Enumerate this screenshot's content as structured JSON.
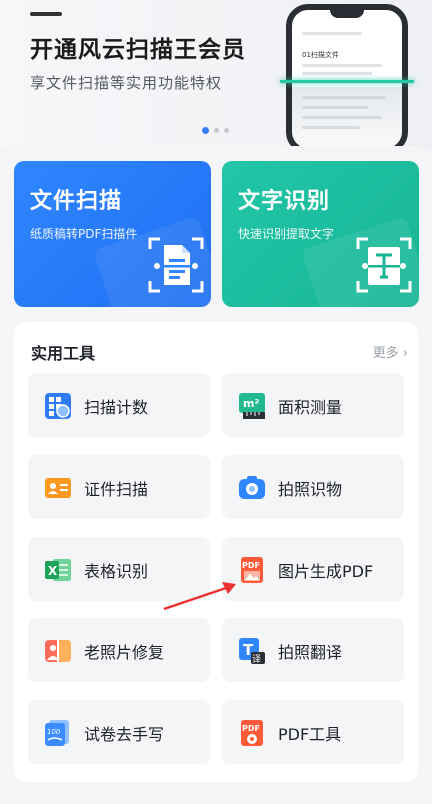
{
  "banner": {
    "title": "开通风云扫描王会员",
    "subtitle": "享文件扫描等实用功能特权",
    "phone_doc_title": "01扫描文件",
    "carousel_dots": 3,
    "active_dot": 0
  },
  "features": [
    {
      "title": "文件扫描",
      "subtitle": "纸质稿转PDF扫描件",
      "icon": "document-scan-icon"
    },
    {
      "title": "文字识别",
      "subtitle": "快速识别提取文字",
      "icon": "text-recognition-icon"
    }
  ],
  "tools": {
    "title": "实用工具",
    "more": "更多",
    "items": [
      {
        "label": "扫描计数",
        "icon": "scan-count-icon"
      },
      {
        "label": "面积测量",
        "icon": "area-measure-icon",
        "icon_text": "m²"
      },
      {
        "label": "证件扫描",
        "icon": "id-card-icon"
      },
      {
        "label": "拍照识物",
        "icon": "camera-icon"
      },
      {
        "label": "表格识别",
        "icon": "excel-icon",
        "icon_text": "X"
      },
      {
        "label": "图片生成PDF",
        "icon": "image-to-pdf-icon",
        "icon_text": "PDF"
      },
      {
        "label": "老照片修复",
        "icon": "photo-restore-icon"
      },
      {
        "label": "拍照翻译",
        "icon": "translate-icon",
        "icon_text": "T",
        "badge_text": "译"
      },
      {
        "label": "试卷去手写",
        "icon": "exam-paper-icon",
        "icon_text": "100"
      },
      {
        "label": "PDF工具",
        "icon": "pdf-tool-icon",
        "icon_text": "PDF"
      }
    ]
  },
  "colors": {
    "scan_card": "#2f86ff",
    "ocr_card": "#22c6a8",
    "accent_blue": "#3a7bf5",
    "arrow_red": "#e8312e"
  }
}
